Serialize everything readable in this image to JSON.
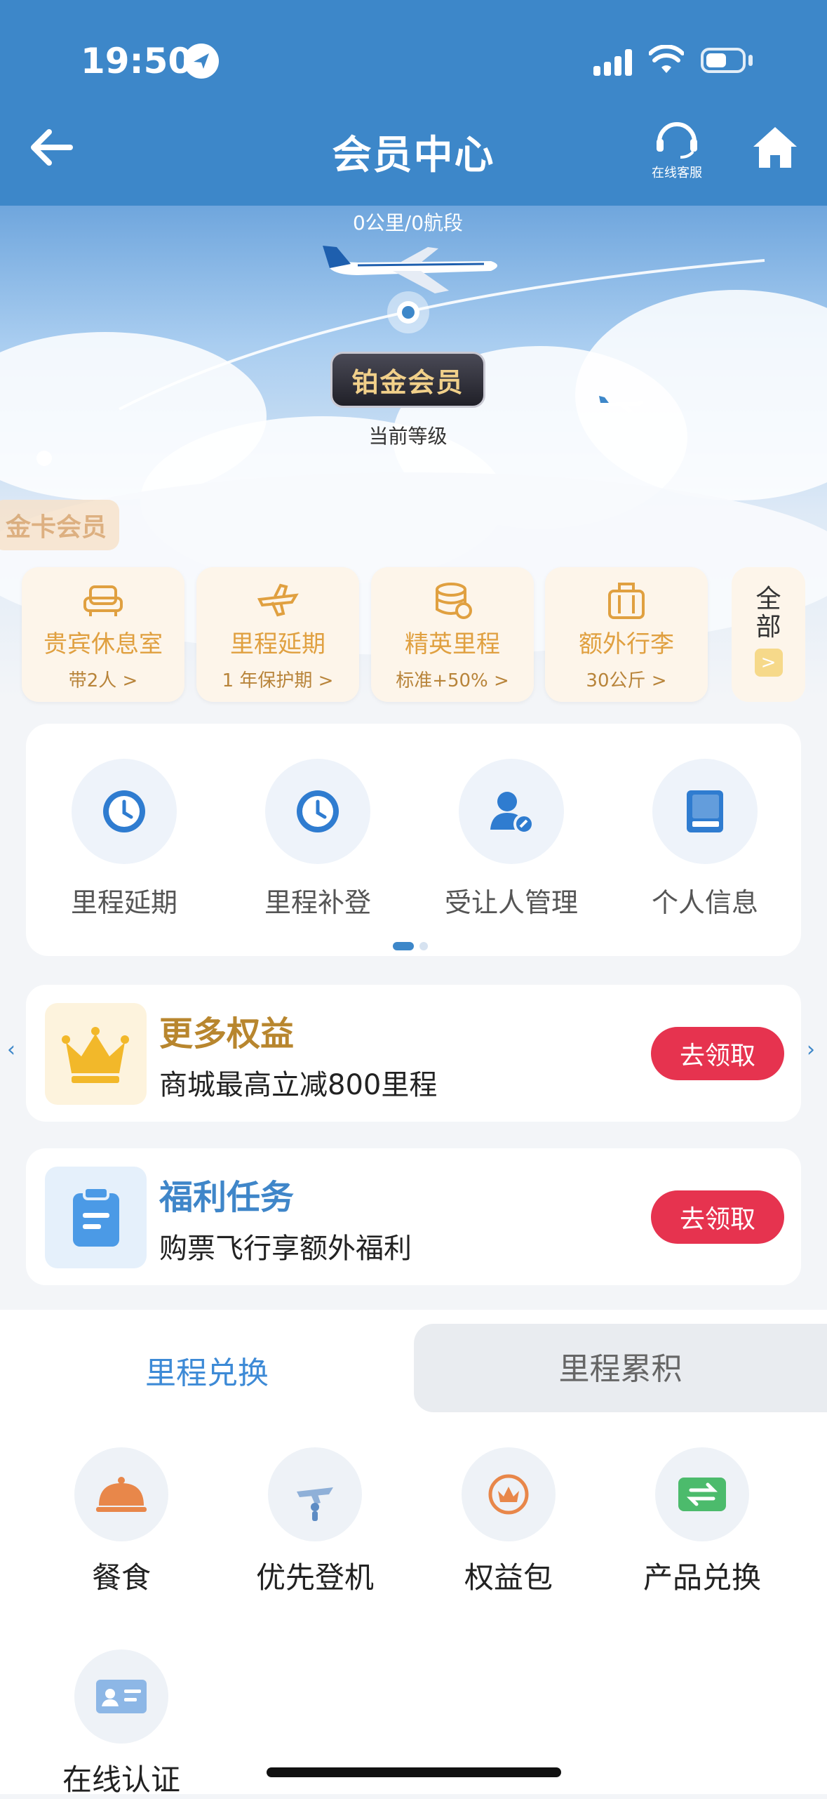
{
  "status_bar": {
    "time": "19:50"
  },
  "header": {
    "title": "会员中心",
    "service_label": "在线客服"
  },
  "hero": {
    "mileage": "0公里/0航段",
    "level": "铂金会员",
    "level_caption": "当前等级",
    "prev_level_tag": "金卡会员"
  },
  "benefits": [
    {
      "title": "贵宾休息室",
      "sub": "带2人 >",
      "icon": "sofa-icon"
    },
    {
      "title": "里程延期",
      "sub": "1 年保护期 >",
      "icon": "plane-extend-icon"
    },
    {
      "title": "精英里程",
      "sub": "标准+50% >",
      "icon": "coins-icon"
    },
    {
      "title": "额外行李",
      "sub": "30公斤 >",
      "icon": "luggage-icon"
    }
  ],
  "benefits_all": {
    "label": "全部",
    "arrow": ">"
  },
  "quick_actions": [
    {
      "label": "里程延期",
      "icon": "clock-icon"
    },
    {
      "label": "里程补登",
      "icon": "clock-icon"
    },
    {
      "label": "受让人管理",
      "icon": "user-manage-icon"
    },
    {
      "label": "个人信息",
      "icon": "book-icon"
    }
  ],
  "promos": [
    {
      "title": "更多权益",
      "subtitle": "商城最高立减800里程",
      "button": "去领取",
      "icon": "crown-icon",
      "title_color": "#b8862e"
    },
    {
      "title": "福利任务",
      "subtitle": "购票飞行享额外福利",
      "button": "去领取",
      "icon": "clipboard-icon",
      "title_color": "#3f86c9"
    }
  ],
  "tabs": {
    "active": "里程兑换",
    "inactive": "里程累积"
  },
  "exchange_items": [
    {
      "label": "餐食",
      "icon": "cloche-icon"
    },
    {
      "label": "优先登机",
      "icon": "boarding-icon"
    },
    {
      "label": "权益包",
      "icon": "crown-badge-icon"
    },
    {
      "label": "产品兑换",
      "icon": "exchange-icon"
    },
    {
      "label": "在线认证",
      "icon": "id-card-icon"
    }
  ],
  "colors": {
    "header_blue": "#3d87c9",
    "button_red": "#e6334f",
    "gold": "#e0a040"
  }
}
